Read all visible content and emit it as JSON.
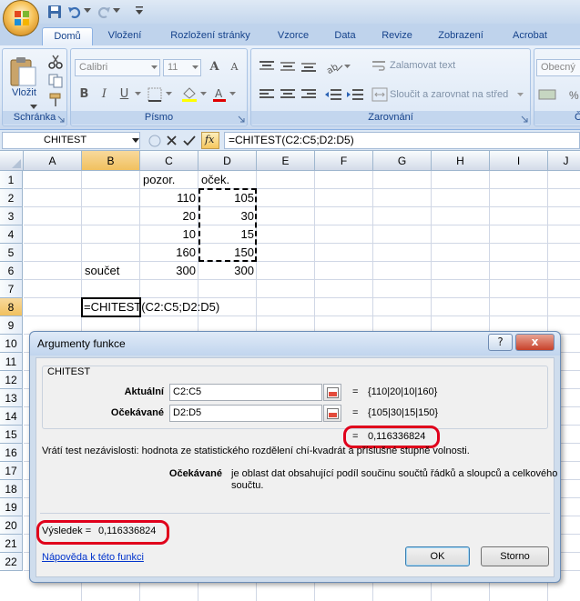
{
  "tabs": [
    {
      "label": "Domů",
      "active": true
    },
    {
      "label": "Vložení"
    },
    {
      "label": "Rozložení stránky"
    },
    {
      "label": "Vzorce"
    },
    {
      "label": "Data"
    },
    {
      "label": "Revize"
    },
    {
      "label": "Zobrazení"
    },
    {
      "label": "Acrobat"
    }
  ],
  "ribbon": {
    "paste_label": "Vložit",
    "clipboard_group": "Schránka",
    "font_group": "Písmo",
    "alignment_group": "Zarovnání",
    "font_name": "Calibri",
    "font_size": "11",
    "wrap_text": "Zalamovat text",
    "merge_center": "Sloučit a zarovnat na střed",
    "number_format": "Obecný",
    "bold": "B",
    "italic": "I",
    "underline": "U",
    "font_grow": "A",
    "font_shrink": "A",
    "percent": "%",
    "next_group_initial": "Č"
  },
  "formula_bar": {
    "name_box": "CHITEST",
    "fx": "fx",
    "formula": "=CHITEST(C2:C5;D2:D5)"
  },
  "columns": [
    "A",
    "B",
    "C",
    "D",
    "E",
    "F",
    "G",
    "H",
    "I",
    "J"
  ],
  "rows": [
    "1",
    "2",
    "3",
    "4",
    "5",
    "6",
    "7",
    "8",
    "9",
    "10",
    "11",
    "12",
    "13",
    "14",
    "15",
    "16",
    "17",
    "18",
    "19",
    "20",
    "21",
    "22"
  ],
  "cells": {
    "C1": "pozor.",
    "D1": "oček.",
    "C2": "110",
    "D2": "105",
    "C3": "20",
    "D3": "30",
    "C4": "10",
    "D4": "15",
    "C5": "160",
    "D5": "150",
    "B6": "součet",
    "C6": "300",
    "D6": "300",
    "B8": "=CHITEST(C2:C5;D2:D5)"
  },
  "dialog": {
    "title": "Argumenty funkce",
    "help_btn": "?",
    "close_btn": "x",
    "function_name": "CHITEST",
    "arg1_label": "Aktuální",
    "arg1_value": "C2:C5",
    "arg1_result": "{110|20|10|160}",
    "arg2_label": "Očekávané",
    "arg2_value": "D2:D5",
    "arg2_result": "{105|30|15|150}",
    "equals": "=",
    "formula_result": "0,116336824",
    "description": "Vrátí test nezávislosti: hodnota ze statistického rozdělení chí-kvadrát a příslušné stupně volnosti.",
    "arg_help_label": "Očekávané",
    "arg_help_line1": "je oblast dat obsahující podíl součinu součtů řádků a sloupců a celkového",
    "arg_help_line2": "součtu.",
    "result_label": "Výsledek =",
    "result_value": "0,116336824",
    "help_link": "Nápověda k této funkci",
    "ok": "OK",
    "cancel": "Storno"
  }
}
